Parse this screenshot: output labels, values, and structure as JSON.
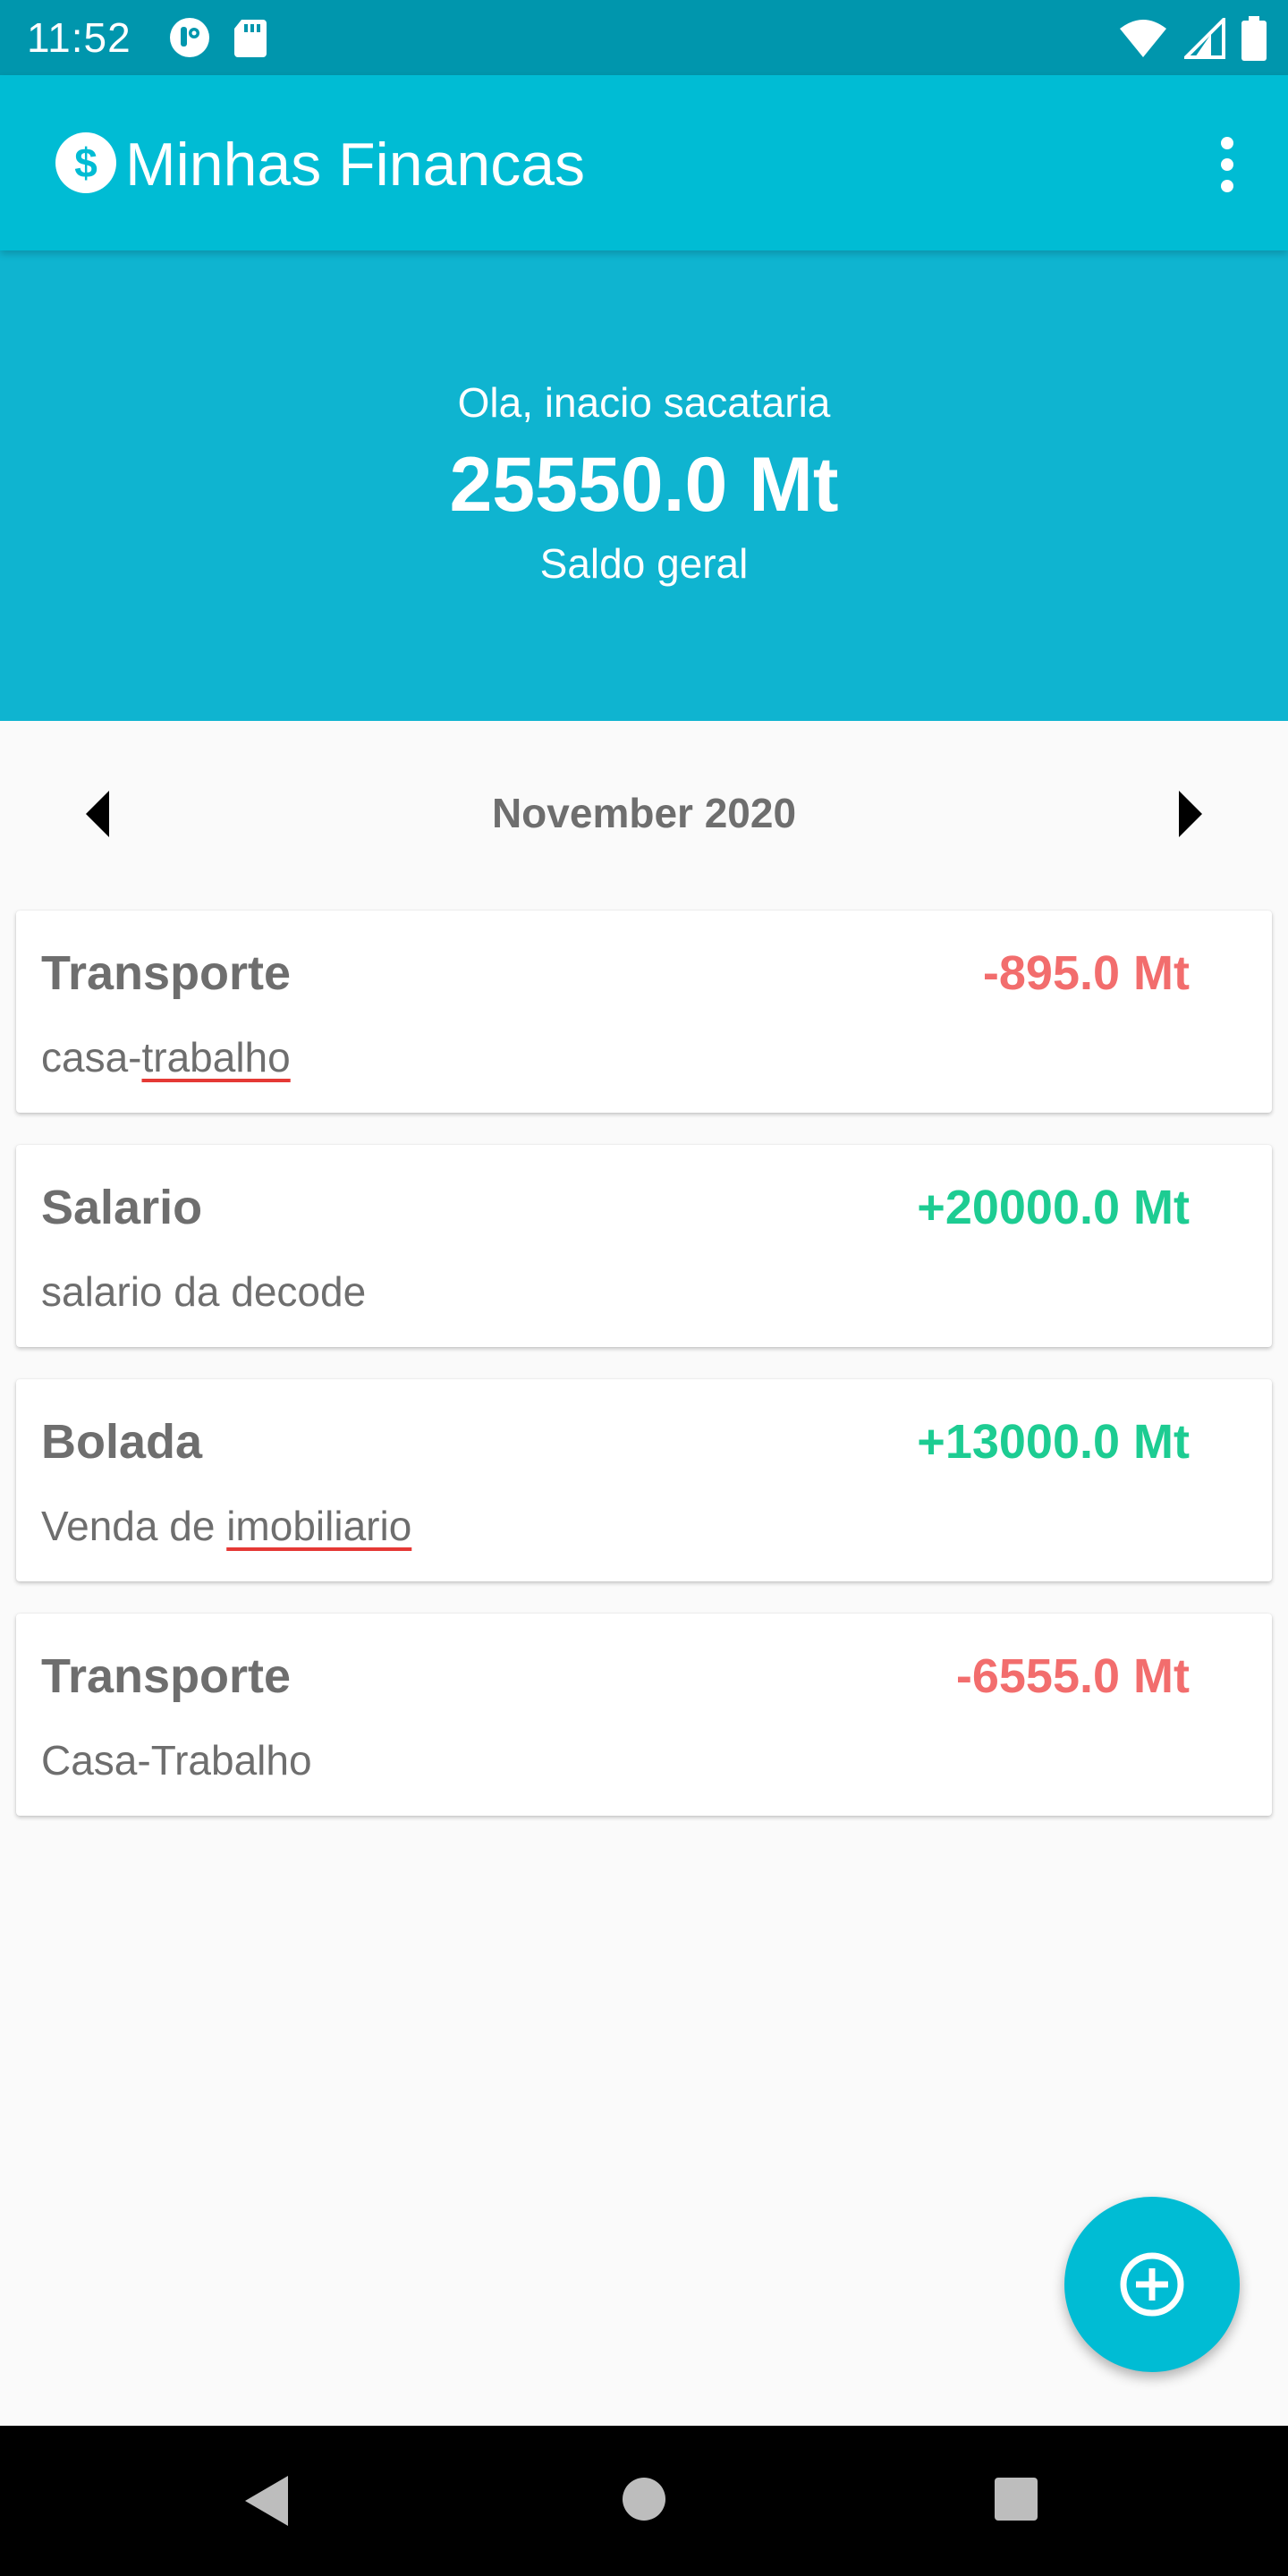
{
  "status_bar": {
    "time": "11:52",
    "left_icons": [
      "app-notification-icon",
      "sd-card-icon"
    ],
    "right_icons": [
      "wifi-icon",
      "cell-signal-icon",
      "battery-icon"
    ]
  },
  "app_bar": {
    "title": "Minhas Financas",
    "logo_icon": "dollar-circle-icon",
    "menu_icon": "more-vert-icon"
  },
  "header": {
    "greeting": "Ola, inacio sacataria",
    "balance": "25550.0 Mt",
    "balance_label": "Saldo geral"
  },
  "month_nav": {
    "label": "November 2020",
    "prev_icon": "arrow-left-icon",
    "next_icon": "arrow-right-icon"
  },
  "transactions": [
    {
      "category": "Transporte",
      "amount": "-895.0 Mt",
      "desc_plain": "casa-",
      "desc_marked": "trabalho",
      "type": "expense"
    },
    {
      "category": "Salario",
      "amount": "+20000.0 Mt",
      "desc_plain": "salario da decode",
      "desc_marked": "",
      "type": "income"
    },
    {
      "category": "Bolada",
      "amount": "+13000.0 Mt",
      "desc_plain": "Venda de ",
      "desc_marked": "imobiliario",
      "type": "income"
    },
    {
      "category": "Transporte",
      "amount": "-6555.0 Mt",
      "desc_plain": "Casa-Trabalho",
      "desc_marked": "",
      "type": "expense"
    }
  ],
  "fab": {
    "icon": "add-circle-icon"
  },
  "colors": {
    "primary": "#00bcd4",
    "status_bar": "#0096ad",
    "header": "#0fb4d0",
    "expense": "#f26d6d",
    "income": "#1dcc92",
    "text_gray": "#6e6e6e"
  },
  "nav_bar": {
    "icons": [
      "back-icon",
      "home-icon",
      "recents-icon"
    ]
  }
}
